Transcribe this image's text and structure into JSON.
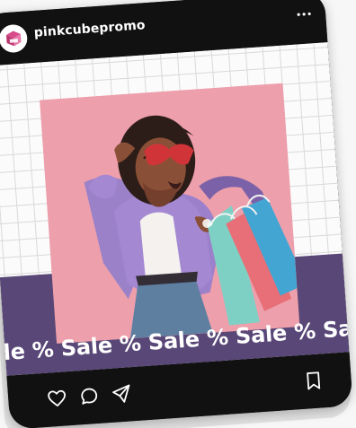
{
  "post": {
    "username": "pinkcubepromo",
    "banner_text": "ale % Sale % Sale % Sale % Sa",
    "avatar_logo_text": "pinkcube",
    "icons": {
      "more": "more-options-icon",
      "like": "heart-icon",
      "comment": "comment-icon",
      "share": "share-icon",
      "save": "bookmark-icon"
    }
  },
  "colors": {
    "phone": "#111111",
    "accent_purple": "#584777",
    "photo_bg": "#ed9fab",
    "text": "#ffffff"
  }
}
